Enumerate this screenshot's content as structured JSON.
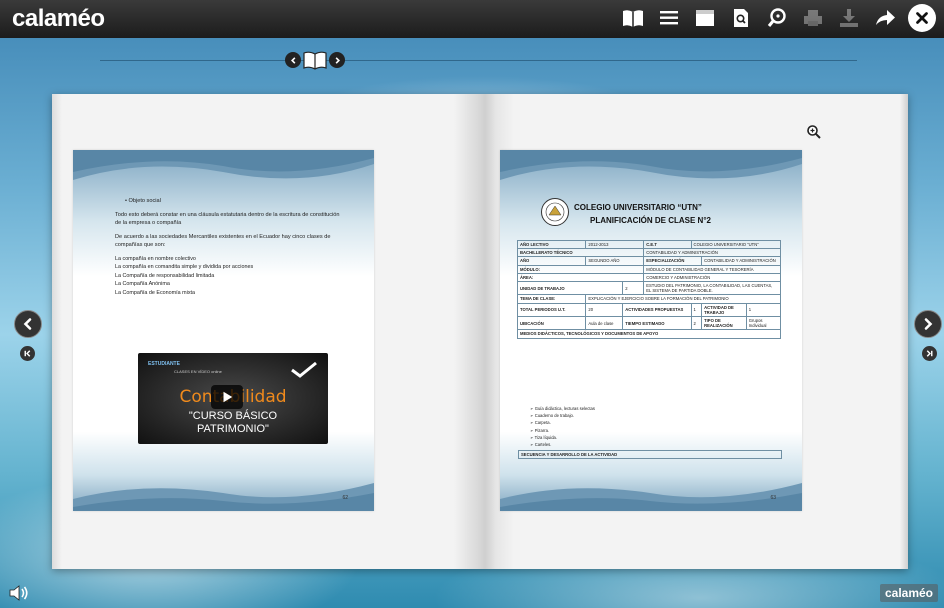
{
  "app": {
    "logo_text": "calaméo",
    "brand_text": "calaméo"
  },
  "toolbar": {
    "icons": [
      "book-view-icon",
      "list-view-icon",
      "fullscreen-icon",
      "search-document-icon",
      "zoom-search-icon",
      "print-icon",
      "download-icon",
      "share-icon",
      "close-icon"
    ]
  },
  "left_page": {
    "bullet": "Objeto social",
    "para1": "Todo esto deberá constar en una cláusula estatutaria dentro de la escritura de constitución de la empresa o compañía",
    "para2": "De acuerdo a las sociedades Mercantiles existentes en el Ecuador hay cinco clases de compañías que son:",
    "items": [
      "La compañía en nombre colectivo",
      "La compañía en comandita simple y dividida por acciones",
      "La Compañía de responsabilidad limitada",
      "La Compañía Anónima",
      "La Compañía de Economía mixta"
    ],
    "page_number": "62",
    "video": {
      "badge": "ESTUDIANTE",
      "caption": "CLASES EN VÍDEO online",
      "main": "Contabilidad",
      "sub1": "\"CURSO BÁSICO",
      "sub2": "PATRIMONIO\""
    }
  },
  "right_page": {
    "title1": "COLEGIO UNIVERSITARIO “UTN”",
    "title2": "PLANIFICACIÓN DE CLASE N°2",
    "table": {
      "anio_lectivo_label": "AÑO LECTIVO",
      "anio_lectivo_value": "2012-2013",
      "cet_label": "C.E.T",
      "cet_value": "COLEGIO UNIVERSITARIO “UTN”",
      "bach_label": "BACHILLERATO TÉCNICO",
      "bach_value": "CONTABILIDAD Y ADMINISTRACIÓN",
      "anio_label": "AÑO",
      "anio_value": "SEGUNDO AÑO",
      "esp_label": "ESPECIALIZACIÓN",
      "esp_value": "CONTABILIDAD Y ADMINISTRACIÓN",
      "modulo_label": "MÓDULO:",
      "modulo_value": "MÓDULO DE CONTABILIDAD GENERAL Y TESORERÍA",
      "area_label": "ÁREA:",
      "area_value": "COMERCIO Y ADMINISTRACIÓN",
      "unidad_label": "UNIDAD DE TRABAJO",
      "unidad_num": "2",
      "unidad_value": "ESTUDIO DEL PATRIMONIO, LA CONTABILIDAD, LAS CUENTAS, EL SISTEMA DE PARTIDA DOBLE.",
      "tema_label": "TEMA DE CLASE:",
      "tema_value": "EXPLICACIÓN Y EJERCICIO SOBRE LA FORMACIÓN DEL PATRIMONIO",
      "total_label": "TOTAL PERIODOS U.T.",
      "total_value": "20",
      "act_prop_label": "ACTIVIDADES PROPUESTAS",
      "act_prop_value": "1",
      "act_trab_label": "ACTIVIDAD DE TRABAJO",
      "act_trab_value": "1",
      "ubic_label": "UBICACIÓN",
      "ubic_value": "Aula de clase",
      "tiempo_label": "TIEMPO ESTIMADO",
      "tiempo_value": "2",
      "tipo_label": "TIPO DE REALIZACIÓN",
      "tipo_opt1": "Grupos",
      "tipo_opt2": "Individual",
      "medios_label": "MEDIOS DIDÁCTICOS, TECNOLÓGICOS Y DOCUMENTOS DE APOYO"
    },
    "list": [
      "Guía didáctica, lecturas selectas",
      "Cuaderno de trabajo.",
      "Carpeta.",
      "Pizarra.",
      "Tiza líquida.",
      "Carteles."
    ],
    "last_row": "SECUENCIA Y DESARROLLO DE LA ACTIVIDAD",
    "page_number": "63"
  },
  "colors": {
    "topbar": "#1c1c1c",
    "page_blue": "#7fa7c2",
    "accent_orange": "#f08a1c"
  }
}
